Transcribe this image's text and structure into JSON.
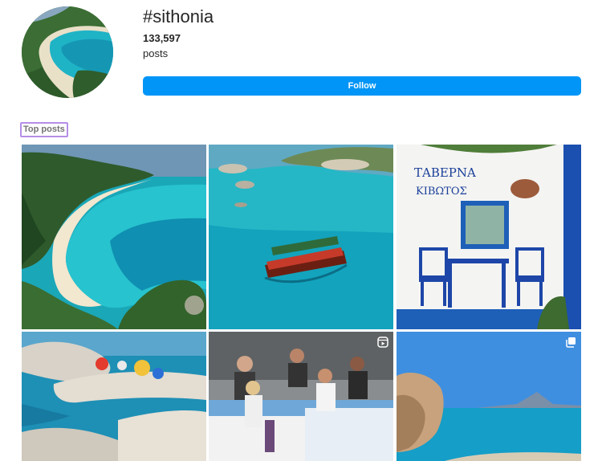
{
  "header": {
    "hashtag": "#sithonia",
    "post_count": "133,597",
    "post_count_label": "posts",
    "follow_label": "Follow"
  },
  "section": {
    "top_posts_label": "Top posts"
  },
  "colors": {
    "follow_button": "#0095f6",
    "highlight_border": "#b48ee6"
  },
  "posts": [
    {
      "name": "aerial-beach-cove",
      "type": "image",
      "badge": ""
    },
    {
      "name": "boat-turquoise-bay",
      "type": "image",
      "badge": ""
    },
    {
      "name": "taverna-blue-chairs",
      "type": "image",
      "badge": "",
      "sign_line1": "ΤΑΒΕΡΝΑ",
      "sign_line2": "ΚΙΒΩΤΟΣ"
    },
    {
      "name": "rocky-beach-umbrellas",
      "type": "image",
      "badge": ""
    },
    {
      "name": "restaurant-diners",
      "type": "reel",
      "badge": "reel-icon"
    },
    {
      "name": "rock-sea-mountain",
      "type": "carousel",
      "badge": "carousel-icon"
    }
  ]
}
